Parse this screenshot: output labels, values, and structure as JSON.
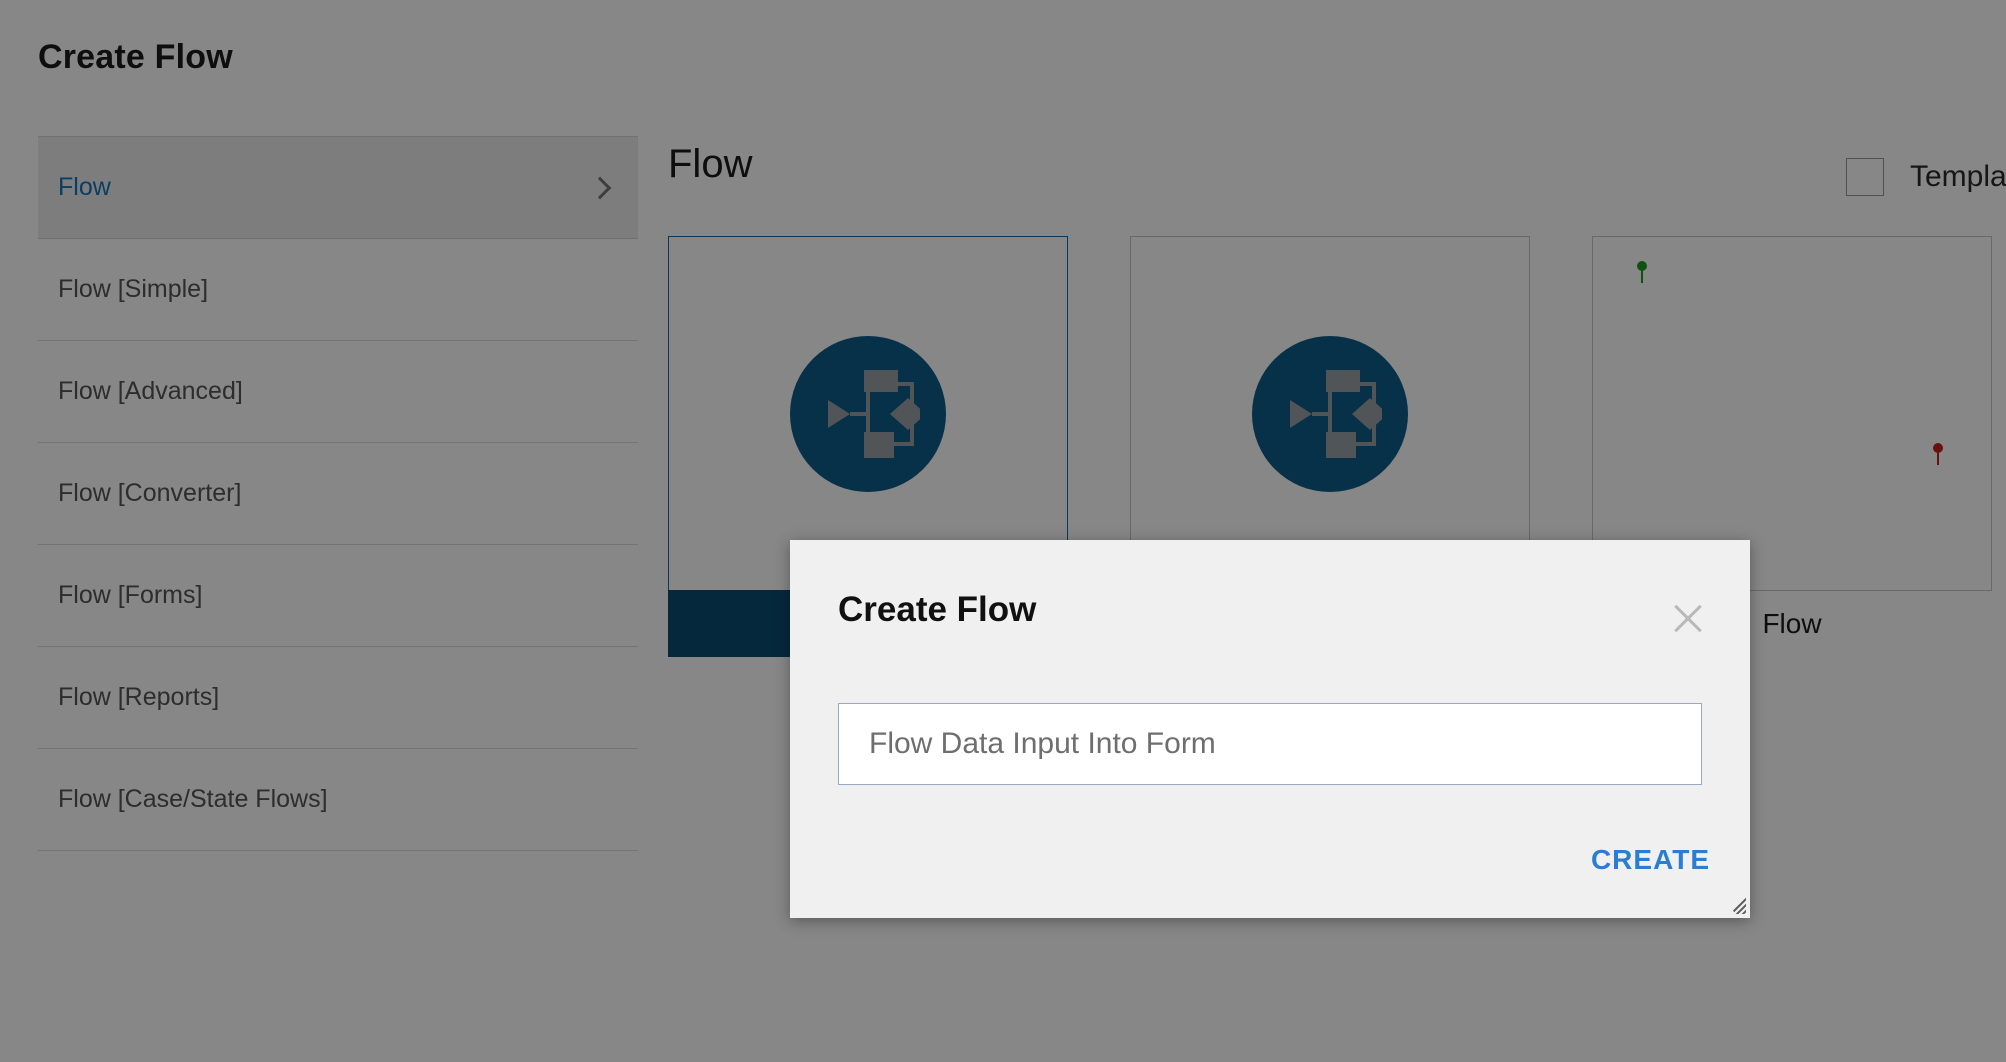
{
  "page": {
    "title": "Create Flow"
  },
  "sidebar": {
    "items": [
      {
        "label": "Flow",
        "selected": true,
        "chevron": "chevron-right-icon"
      },
      {
        "label": "Flow [Simple]",
        "selected": false
      },
      {
        "label": "Flow [Advanced]",
        "selected": false
      },
      {
        "label": "Flow [Converter]",
        "selected": false
      },
      {
        "label": "Flow [Forms]",
        "selected": false
      },
      {
        "label": "Flow [Reports]",
        "selected": false
      },
      {
        "label": "Flow [Case/State Flows]",
        "selected": false
      }
    ]
  },
  "main": {
    "heading": "Flow",
    "template_checkbox": {
      "label": "Template",
      "checked": false
    },
    "cards": [
      {
        "icon": "flow-diagram-icon",
        "selected": true,
        "caption": ""
      },
      {
        "icon": "flow-diagram-icon",
        "selected": false,
        "caption": ""
      },
      {
        "icon": "map-pins-icon",
        "selected": false,
        "caption": "Flow"
      }
    ]
  },
  "modal": {
    "title": "Create Flow",
    "close_icon": "close-icon",
    "input_value": "Flow Data Input Into Form",
    "input_placeholder": "Flow Data Input Into Form",
    "create_label": "CREATE",
    "resize_handle": "resize-grip-icon"
  },
  "colors": {
    "accent_blue": "#1876b8",
    "icon_blue": "#0f5c8a",
    "selection_bar": "#0c4c73",
    "create_link": "#2b7cd3",
    "pin_green": "#1e9c1e",
    "pin_red": "#c42020"
  }
}
